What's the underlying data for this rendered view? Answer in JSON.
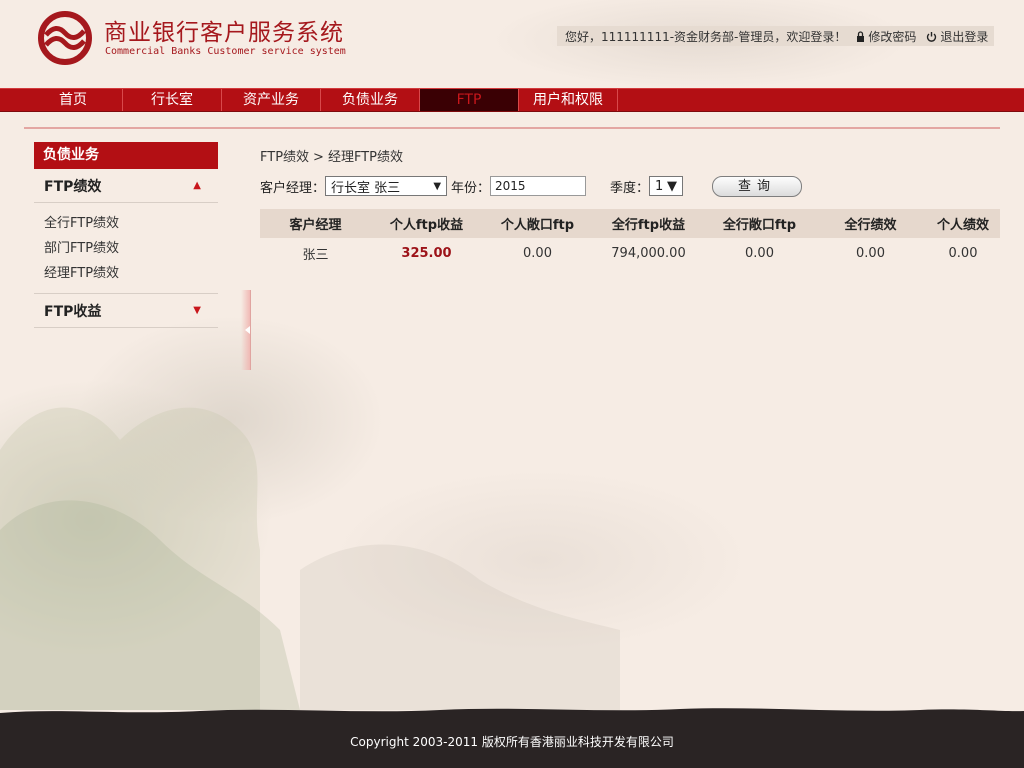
{
  "header": {
    "title": "商业银行客户服务系统",
    "subtitle": "Commercial Banks Customer service system",
    "greeting": "您好，111111111-资金财务部-管理员，欢迎登录！",
    "change_password": "修改密码",
    "logout": "退出登录"
  },
  "nav": {
    "items": [
      "首页",
      "行长室",
      "资产业务",
      "负债业务",
      "FTP",
      "用户和权限"
    ],
    "active": "FTP"
  },
  "sidebar": {
    "heading": "负债业务",
    "sections": [
      {
        "label": "FTP绩效",
        "arrow": "▲",
        "links": [
          "全行FTP绩效",
          "部门FTP绩效",
          "经理FTP绩效"
        ]
      },
      {
        "label": "FTP收益",
        "arrow": "▼"
      }
    ]
  },
  "main": {
    "breadcrumb": [
      "FTP绩效",
      ">",
      "经理FTP绩效"
    ],
    "filters": {
      "manager_label": "客户经理：",
      "manager_value": "行长室 张三",
      "year_label": "年份：",
      "year_value": "2015",
      "quarter_label": "季度：",
      "quarter_value": "1",
      "query_button": "查询"
    },
    "table": {
      "columns": [
        "客户经理",
        "个人ftp收益",
        "个人敞口ftp",
        "全行ftp收益",
        "全行敞口ftp",
        "全行绩效",
        "个人绩效"
      ],
      "rows": [
        [
          "张三",
          "325.00",
          "0.00",
          "794,000.00",
          "0.00",
          "0.00",
          "0.00"
        ]
      ]
    }
  },
  "footer": {
    "copyright": "Copyright 2003-2011 版权所有香港丽业科技开发有限公司"
  },
  "colors": {
    "brand_red": "#b30f14",
    "active_nav_bg": "#3a0004",
    "footer_bg": "#2a2424"
  }
}
